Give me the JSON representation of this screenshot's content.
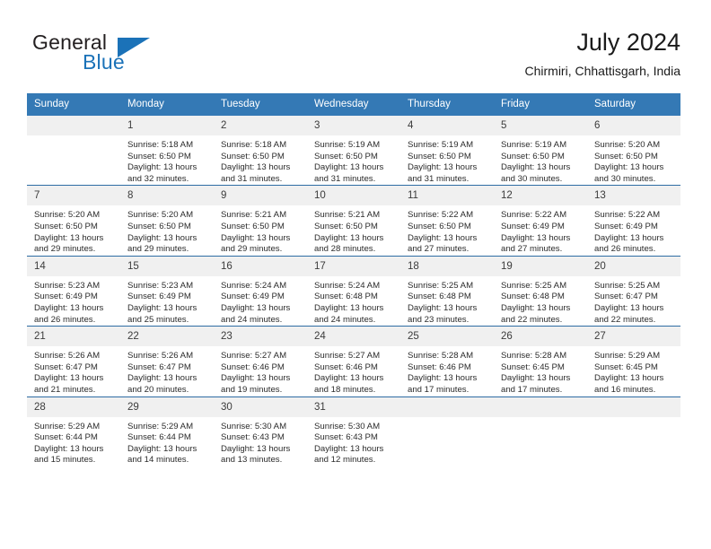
{
  "brand": {
    "word_one": "General",
    "word_two": "Blue",
    "flag_icon": "blue-triangle-flag",
    "dark_color": "#231f20",
    "accent_color": "#1b72b8"
  },
  "header": {
    "title": "July 2024",
    "subtitle": "Chirmiri, Chhattisgarh, India"
  },
  "theme": {
    "header_bg": "#3479b5",
    "header_text": "#ffffff",
    "row_divider": "#2e6da4",
    "daynum_bg": "#f0f0f0",
    "cell_bg": "#ffffff"
  },
  "calendar": {
    "weekday_headers": [
      "Sunday",
      "Monday",
      "Tuesday",
      "Wednesday",
      "Thursday",
      "Friday",
      "Saturday"
    ],
    "weeks": [
      [
        {
          "day": "",
          "sunrise": "",
          "sunset": "",
          "daylight": ""
        },
        {
          "day": "1",
          "sunrise": "Sunrise: 5:18 AM",
          "sunset": "Sunset: 6:50 PM",
          "daylight": "Daylight: 13 hours and 32 minutes."
        },
        {
          "day": "2",
          "sunrise": "Sunrise: 5:18 AM",
          "sunset": "Sunset: 6:50 PM",
          "daylight": "Daylight: 13 hours and 31 minutes."
        },
        {
          "day": "3",
          "sunrise": "Sunrise: 5:19 AM",
          "sunset": "Sunset: 6:50 PM",
          "daylight": "Daylight: 13 hours and 31 minutes."
        },
        {
          "day": "4",
          "sunrise": "Sunrise: 5:19 AM",
          "sunset": "Sunset: 6:50 PM",
          "daylight": "Daylight: 13 hours and 31 minutes."
        },
        {
          "day": "5",
          "sunrise": "Sunrise: 5:19 AM",
          "sunset": "Sunset: 6:50 PM",
          "daylight": "Daylight: 13 hours and 30 minutes."
        },
        {
          "day": "6",
          "sunrise": "Sunrise: 5:20 AM",
          "sunset": "Sunset: 6:50 PM",
          "daylight": "Daylight: 13 hours and 30 minutes."
        }
      ],
      [
        {
          "day": "7",
          "sunrise": "Sunrise: 5:20 AM",
          "sunset": "Sunset: 6:50 PM",
          "daylight": "Daylight: 13 hours and 29 minutes."
        },
        {
          "day": "8",
          "sunrise": "Sunrise: 5:20 AM",
          "sunset": "Sunset: 6:50 PM",
          "daylight": "Daylight: 13 hours and 29 minutes."
        },
        {
          "day": "9",
          "sunrise": "Sunrise: 5:21 AM",
          "sunset": "Sunset: 6:50 PM",
          "daylight": "Daylight: 13 hours and 29 minutes."
        },
        {
          "day": "10",
          "sunrise": "Sunrise: 5:21 AM",
          "sunset": "Sunset: 6:50 PM",
          "daylight": "Daylight: 13 hours and 28 minutes."
        },
        {
          "day": "11",
          "sunrise": "Sunrise: 5:22 AM",
          "sunset": "Sunset: 6:50 PM",
          "daylight": "Daylight: 13 hours and 27 minutes."
        },
        {
          "day": "12",
          "sunrise": "Sunrise: 5:22 AM",
          "sunset": "Sunset: 6:49 PM",
          "daylight": "Daylight: 13 hours and 27 minutes."
        },
        {
          "day": "13",
          "sunrise": "Sunrise: 5:22 AM",
          "sunset": "Sunset: 6:49 PM",
          "daylight": "Daylight: 13 hours and 26 minutes."
        }
      ],
      [
        {
          "day": "14",
          "sunrise": "Sunrise: 5:23 AM",
          "sunset": "Sunset: 6:49 PM",
          "daylight": "Daylight: 13 hours and 26 minutes."
        },
        {
          "day": "15",
          "sunrise": "Sunrise: 5:23 AM",
          "sunset": "Sunset: 6:49 PM",
          "daylight": "Daylight: 13 hours and 25 minutes."
        },
        {
          "day": "16",
          "sunrise": "Sunrise: 5:24 AM",
          "sunset": "Sunset: 6:49 PM",
          "daylight": "Daylight: 13 hours and 24 minutes."
        },
        {
          "day": "17",
          "sunrise": "Sunrise: 5:24 AM",
          "sunset": "Sunset: 6:48 PM",
          "daylight": "Daylight: 13 hours and 24 minutes."
        },
        {
          "day": "18",
          "sunrise": "Sunrise: 5:25 AM",
          "sunset": "Sunset: 6:48 PM",
          "daylight": "Daylight: 13 hours and 23 minutes."
        },
        {
          "day": "19",
          "sunrise": "Sunrise: 5:25 AM",
          "sunset": "Sunset: 6:48 PM",
          "daylight": "Daylight: 13 hours and 22 minutes."
        },
        {
          "day": "20",
          "sunrise": "Sunrise: 5:25 AM",
          "sunset": "Sunset: 6:47 PM",
          "daylight": "Daylight: 13 hours and 22 minutes."
        }
      ],
      [
        {
          "day": "21",
          "sunrise": "Sunrise: 5:26 AM",
          "sunset": "Sunset: 6:47 PM",
          "daylight": "Daylight: 13 hours and 21 minutes."
        },
        {
          "day": "22",
          "sunrise": "Sunrise: 5:26 AM",
          "sunset": "Sunset: 6:47 PM",
          "daylight": "Daylight: 13 hours and 20 minutes."
        },
        {
          "day": "23",
          "sunrise": "Sunrise: 5:27 AM",
          "sunset": "Sunset: 6:46 PM",
          "daylight": "Daylight: 13 hours and 19 minutes."
        },
        {
          "day": "24",
          "sunrise": "Sunrise: 5:27 AM",
          "sunset": "Sunset: 6:46 PM",
          "daylight": "Daylight: 13 hours and 18 minutes."
        },
        {
          "day": "25",
          "sunrise": "Sunrise: 5:28 AM",
          "sunset": "Sunset: 6:46 PM",
          "daylight": "Daylight: 13 hours and 17 minutes."
        },
        {
          "day": "26",
          "sunrise": "Sunrise: 5:28 AM",
          "sunset": "Sunset: 6:45 PM",
          "daylight": "Daylight: 13 hours and 17 minutes."
        },
        {
          "day": "27",
          "sunrise": "Sunrise: 5:29 AM",
          "sunset": "Sunset: 6:45 PM",
          "daylight": "Daylight: 13 hours and 16 minutes."
        }
      ],
      [
        {
          "day": "28",
          "sunrise": "Sunrise: 5:29 AM",
          "sunset": "Sunset: 6:44 PM",
          "daylight": "Daylight: 13 hours and 15 minutes."
        },
        {
          "day": "29",
          "sunrise": "Sunrise: 5:29 AM",
          "sunset": "Sunset: 6:44 PM",
          "daylight": "Daylight: 13 hours and 14 minutes."
        },
        {
          "day": "30",
          "sunrise": "Sunrise: 5:30 AM",
          "sunset": "Sunset: 6:43 PM",
          "daylight": "Daylight: 13 hours and 13 minutes."
        },
        {
          "day": "31",
          "sunrise": "Sunrise: 5:30 AM",
          "sunset": "Sunset: 6:43 PM",
          "daylight": "Daylight: 13 hours and 12 minutes."
        },
        {
          "day": "",
          "sunrise": "",
          "sunset": "",
          "daylight": ""
        },
        {
          "day": "",
          "sunrise": "",
          "sunset": "",
          "daylight": ""
        },
        {
          "day": "",
          "sunrise": "",
          "sunset": "",
          "daylight": ""
        }
      ]
    ]
  }
}
